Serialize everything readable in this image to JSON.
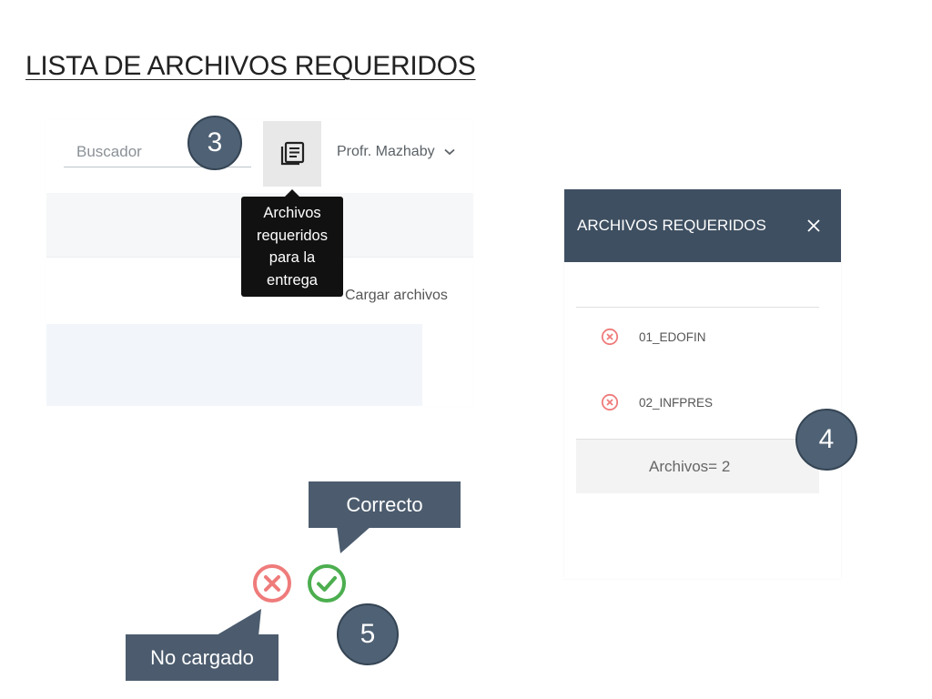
{
  "slide": {
    "title": "LISTA DE ARCHIVOS REQUERIDOS"
  },
  "app_toolbar": {
    "search_placeholder": "Buscador",
    "user_name": "Profr. Mazhaby",
    "upload_label": "Cargar archivos",
    "files_icon": "document-list-icon"
  },
  "tooltip": {
    "lines": [
      "Archivos",
      "requeridos",
      "para la",
      "entrega"
    ]
  },
  "steps": {
    "three": "3",
    "four": "4",
    "five": "5"
  },
  "panel": {
    "title": "ARCHIVOS REQUERIDOS",
    "files": [
      {
        "name": "01_EDOFIN",
        "status": "not-loaded"
      },
      {
        "name": "02_INFPRES",
        "status": "not-loaded"
      }
    ],
    "footer": "Archivos= 2"
  },
  "legend": {
    "correct_label": "Correcto",
    "not_loaded_label": "No cargado"
  },
  "colors": {
    "header": "#3e4f61",
    "callout": "#4c5c6e",
    "step_circle": "#4f6174",
    "error": "#ef7b7b",
    "success": "#4cae4f"
  }
}
